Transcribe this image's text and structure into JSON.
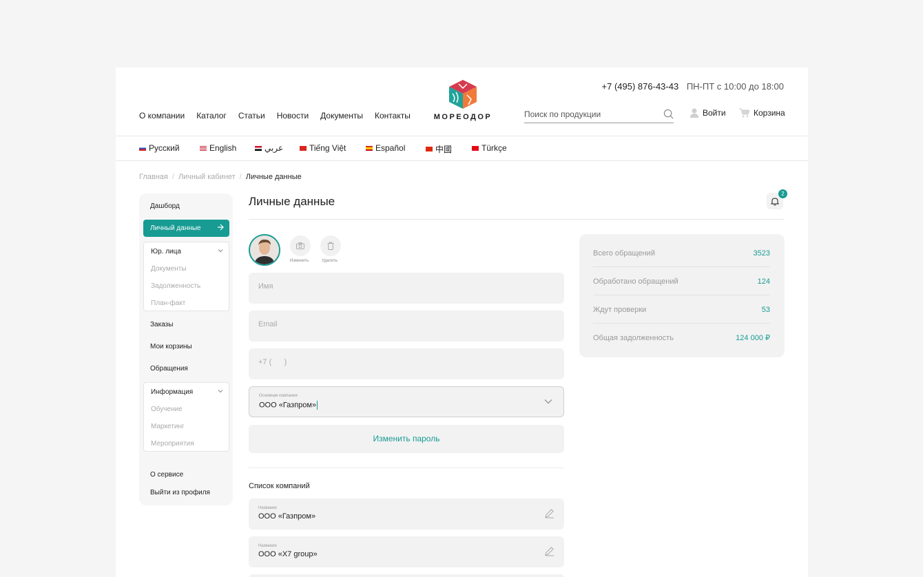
{
  "header": {
    "phone": "+7 (495) 876-43-43",
    "hours": "ПН-ПТ с 10:00 до 18:00",
    "brand": "МОРЕОДОР",
    "nav": [
      "О компании",
      "Каталог",
      "Статьи",
      "Новости",
      "Документы",
      "Контакты"
    ],
    "search_placeholder": "Поиск по продукции",
    "login_label": "Войти",
    "cart_label": "Корзина"
  },
  "languages": [
    {
      "label": "Русский",
      "flag": "ru"
    },
    {
      "label": "English",
      "flag": "us"
    },
    {
      "label": "عربي",
      "flag": "eg"
    },
    {
      "label": "Tiếng Việt",
      "flag": "vn"
    },
    {
      "label": "Español",
      "flag": "es"
    },
    {
      "label": "中國",
      "flag": "cn"
    },
    {
      "label": "Türkçe",
      "flag": "tr"
    }
  ],
  "breadcrumb": [
    "Главная",
    "Личный кабинет",
    "Личные данные"
  ],
  "sidebar": {
    "dashboard": "Дашборд",
    "active": "Личный данные",
    "legal": {
      "label": "Юр. лица",
      "items": [
        "Документы",
        "Задолженность",
        "План-факт"
      ]
    },
    "orders": "Заказы",
    "carts": "Мои корзины",
    "requests": "Обращения",
    "info": {
      "label": "Информация",
      "items": [
        "Обучение",
        "Маркетинг",
        "Мероприятия"
      ]
    },
    "about": "О сервисе",
    "logout": "Выйти из профиля"
  },
  "page": {
    "title": "Личные данные",
    "notifications_count": "2",
    "avatar_actions": {
      "change": "Изменить",
      "delete": "Удалить"
    },
    "fields": {
      "name_placeholder": "Имя",
      "email_placeholder": "Email",
      "phone_placeholder": "+7 (      )",
      "company_label": "Основная компания",
      "company_value": "ООО «Газпром»"
    },
    "change_password": "Изменить пароль",
    "companies_title": "Список компаний",
    "companies": [
      {
        "label": "Название",
        "value": "ООО «Газпром»"
      },
      {
        "label": "Название",
        "value": "ООО «X7 group»"
      }
    ]
  },
  "stats": [
    {
      "label": "Всего обращений",
      "value": "3523"
    },
    {
      "label": "Обработано обращений",
      "value": "124"
    },
    {
      "label": "Ждут проверки",
      "value": "53"
    },
    {
      "label": "Общая задолженность",
      "value": "124 000 ₽"
    }
  ],
  "colors": {
    "accent": "#179b93",
    "background": "#f5f5f5",
    "card": "#f2f2f2"
  }
}
